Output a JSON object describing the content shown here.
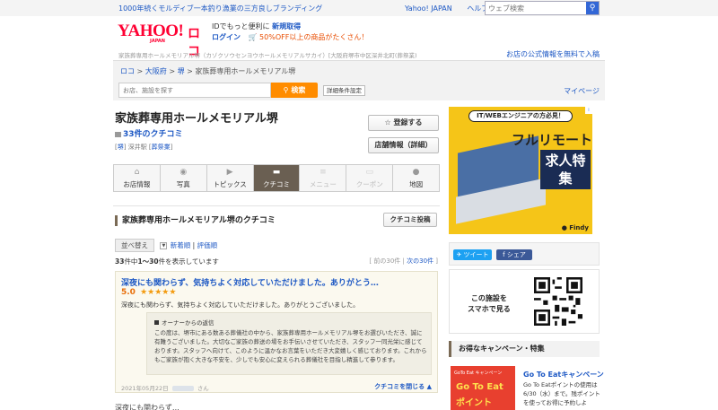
{
  "topbar": {
    "promo": "1000年続くモルディブ一本釣り漁業の三方良しブランディング",
    "links": [
      "Yahoo! JAPAN",
      "ヘルプ"
    ],
    "search_placeholder": "ウェブ検索"
  },
  "header": {
    "logo_yahoo": "YAHOO!",
    "logo_japan": "JAPAN",
    "logo_loco": "ロコ",
    "line1_pre": "IDでもっと便利に",
    "line1_link": "新規取得",
    "login": "ログイン",
    "cart_promo": "🛒 50%OFF以上の商品がたくさん！",
    "address": "家族葬専用ホールメモリアル堺（カゾクソウセンヨウホールメモリアルサカイ）[大阪府堺市中区深井北町(葬祭業)",
    "official_link": "お店の公式情報を無料で入稿"
  },
  "breadcrumb": {
    "items": [
      "ロコ",
      "大阪府",
      "堺"
    ],
    "current": "家族葬専用ホールメモリアル堺",
    "sep": ">"
  },
  "search": {
    "placeholder": "お店、施設を探す",
    "button": "検索",
    "conditions": "詳細条件設定",
    "mypage": "マイページ"
  },
  "shop": {
    "title": "家族葬専用ホールメモリアル堺",
    "review_count": "33件のクチコミ",
    "tags": [
      "堺",
      "深井駅",
      "葬祭業"
    ],
    "register_button": "登録する",
    "info_button": "店舗情報（詳細）"
  },
  "tabs": [
    {
      "label": "お店情報",
      "icon": "⌂",
      "state": "normal"
    },
    {
      "label": "写真",
      "icon": "◉",
      "state": "normal"
    },
    {
      "label": "トピックス",
      "icon": "▶",
      "state": "normal"
    },
    {
      "label": "クチコミ",
      "icon": "▬",
      "state": "active"
    },
    {
      "label": "メニュー",
      "icon": "≡",
      "state": "disabled"
    },
    {
      "label": "クーポン",
      "icon": "▭",
      "state": "disabled"
    },
    {
      "label": "地図",
      "icon": "●",
      "state": "normal"
    }
  ],
  "reviews_section": {
    "title": "家族葬専用ホールメモリアル堺のクチコミ",
    "post_button": "クチコミ投稿",
    "sort_label": "並べ替え",
    "sort_new": "新着順",
    "sort_rating": "評価順",
    "count_total": "33",
    "count_range": "1〜30",
    "count_text_a": "件中",
    "count_text_b": "件を表示しています",
    "prev": "前の30件",
    "next": "次の30件"
  },
  "review": {
    "title": "深夜にも関わらず、気持ちよく対応していただけました。ありがとう…",
    "rating": "5.0",
    "stars": "★★★★★",
    "body": "深夜にも関わらず、気持ちよく対応していただけました。ありがとうございました。",
    "owner_header": "オーナーからの返信",
    "owner_reply": "この度は、堺市にある数ある葬儀社の中から、家族葬専用ホールメモリアル堺をお選びいただき、誠に有難うございました。大切なご家族の葬送の場をお手伝いさせていただき、スタッフ一同光栄に感じております。スタッフへ向けて、このように温かなお言葉をいただき大変嬉しく感じております。これからもご家族が抱く大きな不安を、少しでも安心に変えられる葬儀社を目指し精進して参ります。",
    "date": "2021年05月22日",
    "user_suffix": "さん",
    "close_link": "クチコミを閉じる ▲"
  },
  "next_review_preview": "深夜にも関わらず…",
  "ad": {
    "badge": "IT/WEBエンジニアの方必見！",
    "main": "フルリモート",
    "big": "求人特集",
    "brand": "Findy"
  },
  "share": {
    "tweet": "ツイート",
    "facebook": "シェア"
  },
  "mobile": {
    "text": "この施設を\nスマホで見る"
  },
  "campaign": {
    "header": "お得なキャンペーン・特集",
    "img_line1": "GoTo Eat キャンペーン",
    "img_line2": "Go To Eat",
    "img_line3": "ポイント",
    "title": "Go To Eatキャンペーン",
    "desc": "Go To Eatポイントの使用は6/30（水）まで。残ポイントを使ってお得に予約しよ"
  },
  "colors": {
    "link": "#1d58c4",
    "brand_red": "#ff0033",
    "search_orange": "#ff8c00",
    "active_tab": "#6a5f52",
    "review_bg": "#fbf9ef",
    "ad_yellow": "#f5c518"
  }
}
